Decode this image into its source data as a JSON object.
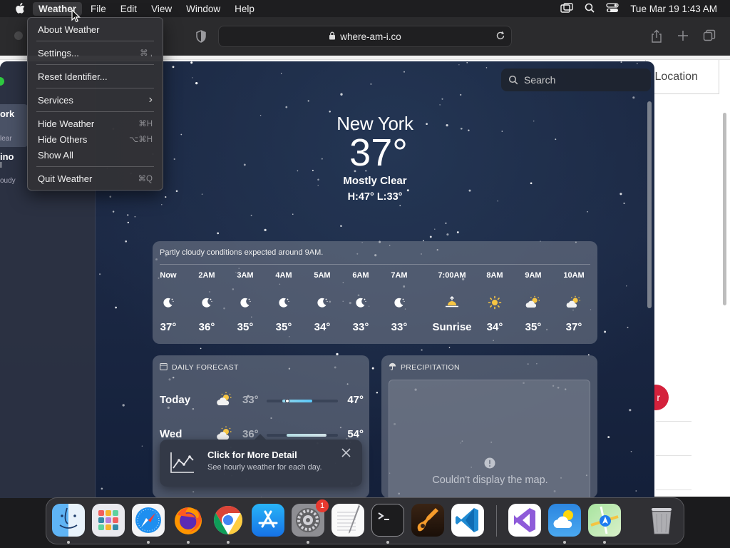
{
  "menubar": {
    "app_name": "Weather",
    "items": [
      "File",
      "Edit",
      "View",
      "Window",
      "Help"
    ],
    "clock": "Tue Mar 19  1:43 AM"
  },
  "app_menu": {
    "items": [
      {
        "label": "About Weather",
        "shortcut": ""
      },
      {
        "label": "Settings...",
        "shortcut": "⌘ ,"
      },
      {
        "label": "Reset Identifier...",
        "shortcut": ""
      },
      {
        "label": "Services",
        "shortcut": "›"
      },
      {
        "label": "Hide Weather",
        "shortcut": "⌘H"
      },
      {
        "label": "Hide Others",
        "shortcut": "⌥⌘H"
      },
      {
        "label": "Show All",
        "shortcut": ""
      },
      {
        "label": "Quit Weather",
        "shortcut": "⌘Q"
      }
    ]
  },
  "browser": {
    "url": "where-am-i.co",
    "location_fragment": "y Location",
    "red_button_fragment": "r"
  },
  "sidebar": {
    "loc1_name": "ork",
    "loc1_sub": "lear",
    "loc2_name": "ino",
    "loc2_line": "l",
    "loc2_sub": "oudy"
  },
  "search": {
    "placeholder": "Search"
  },
  "current": {
    "city": "New York",
    "temp": "37°",
    "condition": "Mostly Clear",
    "hilo": "H:47°  L:33°"
  },
  "hourly": {
    "summary": "Partly cloudy conditions expected around 9AM.",
    "items": [
      {
        "time": "Now",
        "icon": "moon-icon",
        "temp": "37°"
      },
      {
        "time": "2AM",
        "icon": "moon-icon",
        "temp": "36°"
      },
      {
        "time": "3AM",
        "icon": "moon-icon",
        "temp": "35°"
      },
      {
        "time": "4AM",
        "icon": "moon-icon",
        "temp": "35°"
      },
      {
        "time": "5AM",
        "icon": "moon-icon",
        "temp": "34°"
      },
      {
        "time": "6AM",
        "icon": "moon-icon",
        "temp": "33°"
      },
      {
        "time": "7AM",
        "icon": "moon-icon",
        "temp": "33°"
      },
      {
        "time": "7:00AM",
        "icon": "sunrise-icon",
        "temp": "Sunrise"
      },
      {
        "time": "8AM",
        "icon": "sun-icon",
        "temp": "34°"
      },
      {
        "time": "9AM",
        "icon": "partly-cloudy-icon",
        "temp": "35°"
      },
      {
        "time": "10AM",
        "icon": "partly-cloudy-icon",
        "temp": "37°"
      }
    ]
  },
  "daily": {
    "header": "DAILY FORECAST",
    "rows": [
      {
        "day": "Today",
        "icon": "partly-cloudy-icon",
        "low": "33°",
        "high": "47°"
      },
      {
        "day": "Wed",
        "icon": "partly-cloudy-icon",
        "low": "36°",
        "high": "54°"
      }
    ]
  },
  "precipitation": {
    "header": "PRECIPITATION",
    "error": "Couldn't display the map."
  },
  "toast": {
    "title": "Click for More Detail",
    "subtitle": "See hourly weather for each day."
  },
  "dock": {
    "apps": [
      "finder-icon",
      "launchpad-icon",
      "safari-icon",
      "firefox-icon",
      "chrome-icon",
      "app-store-icon",
      "system-settings-icon",
      "textedit-icon",
      "terminal-icon",
      "garageband-icon",
      "vscode-icon",
      "visual-studio-icon",
      "weather-icon",
      "maps-icon",
      "trash-icon"
    ],
    "settings_badge": "1"
  },
  "colors": {
    "accent_blue": "#5ac8fa",
    "close_red": "#d4213c",
    "traffic_green": "#2ec840"
  }
}
